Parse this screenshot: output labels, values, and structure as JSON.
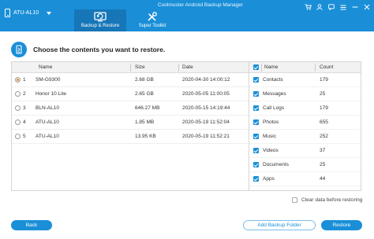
{
  "app": {
    "title": "Coolmuster Android Backup Manager",
    "device": "ATU-AL10",
    "tabs": [
      {
        "label": "Backup & Restore",
        "active": true,
        "icon": "backup-restore-icon"
      },
      {
        "label": "Super Toolkit",
        "active": false,
        "icon": "tools-icon"
      }
    ]
  },
  "colors": {
    "accent": "#1a8fd8",
    "radio_selected": "#e08a2a"
  },
  "heading": "Choose the contents you want to restore.",
  "backups": {
    "columns": [
      "Name",
      "Size",
      "Date"
    ],
    "rows": [
      {
        "index": "1",
        "name": "SM-G9300",
        "size": "2.68 GB",
        "date": "2020-04-30 14:00:12",
        "selected": true
      },
      {
        "index": "2",
        "name": "Honor 10 Lite",
        "size": "2.65 GB",
        "date": "2020-05-05 11:00:05",
        "selected": false
      },
      {
        "index": "3",
        "name": "BLN-AL10",
        "size": "646.27 MB",
        "date": "2020-05-15 14:19:44",
        "selected": false
      },
      {
        "index": "4",
        "name": "ATU-AL10",
        "size": "1.85 MB",
        "date": "2020-05-19 11:52:04",
        "selected": false
      },
      {
        "index": "5",
        "name": "ATU-AL10",
        "size": "13.95 KB",
        "date": "2020-05-19 11:52:21",
        "selected": false
      }
    ]
  },
  "contents": {
    "columns": [
      "Name",
      "Count"
    ],
    "rows": [
      {
        "name": "Contacts",
        "count": "179"
      },
      {
        "name": "Messages",
        "count": "25"
      },
      {
        "name": "Call Logs",
        "count": "179"
      },
      {
        "name": "Photos",
        "count": "655"
      },
      {
        "name": "Music",
        "count": "252"
      },
      {
        "name": "Videos",
        "count": "37"
      },
      {
        "name": "Documents",
        "count": "25"
      },
      {
        "name": "Apps",
        "count": "44"
      }
    ]
  },
  "options": {
    "clear_before_restore": "Clear data before restoring"
  },
  "buttons": {
    "back": "Back",
    "add_folder": "Add Backup Folder",
    "restore": "Restore"
  }
}
